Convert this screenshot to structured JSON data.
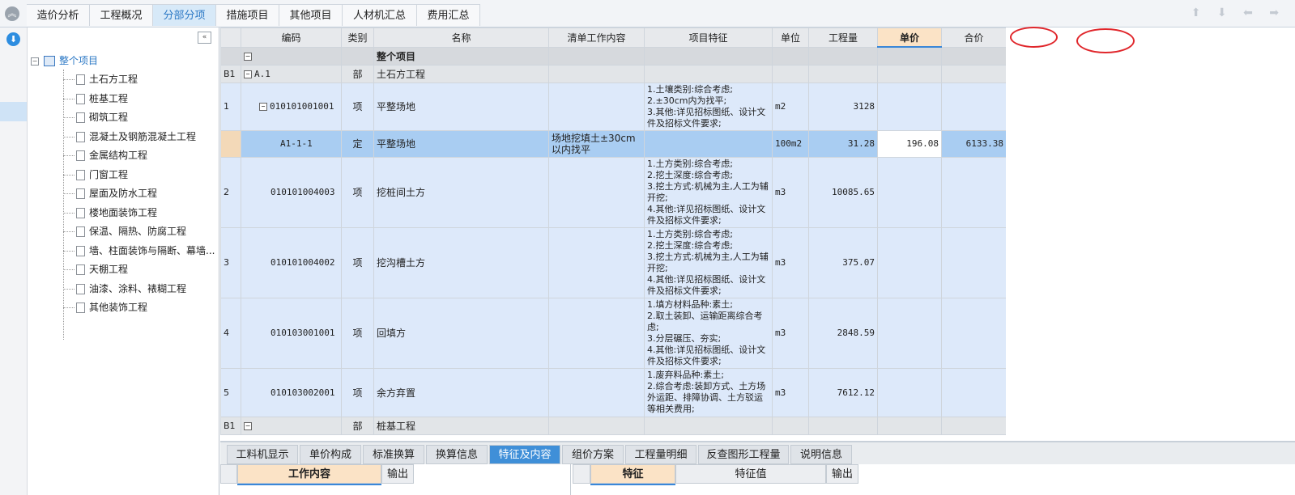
{
  "top_tabs": [
    {
      "label": "造价分析",
      "active": false
    },
    {
      "label": "工程概况",
      "active": false
    },
    {
      "label": "分部分项",
      "active": true
    },
    {
      "label": "措施项目",
      "active": false
    },
    {
      "label": "其他项目",
      "active": false
    },
    {
      "label": "人材机汇总",
      "active": false
    },
    {
      "label": "费用汇总",
      "active": false
    }
  ],
  "nav_arrows": "⬆ ⬇ ⬅ ➡",
  "tree": {
    "root": "整个项目",
    "nodes": [
      "土石方工程",
      "桩基工程",
      "砌筑工程",
      "混凝土及钢筋混凝土工程",
      "金属结构工程",
      "门窗工程",
      "屋面及防水工程",
      "楼地面装饰工程",
      "保温、隔热、防腐工程",
      "墙、柱面装饰与隔断、幕墙...",
      "天棚工程",
      "油漆、涂料、裱糊工程",
      "其他装饰工程"
    ]
  },
  "grid": {
    "headers": [
      "编码",
      "类别",
      "名称",
      "清单工作内容",
      "项目特征",
      "单位",
      "工程量",
      "单价",
      "合价"
    ],
    "rows": [
      {
        "type": "root",
        "idx": "",
        "code": "",
        "cat": "",
        "name": "整个项目",
        "work": "",
        "feat": "",
        "unit": "",
        "qty": "",
        "price": "",
        "total": ""
      },
      {
        "type": "section",
        "idx": "B1",
        "code": "A.1",
        "cat": "部",
        "name": "土石方工程",
        "work": "",
        "feat": "",
        "unit": "",
        "qty": "",
        "price": "",
        "total": ""
      },
      {
        "type": "item",
        "idx": "1",
        "code": "010101001001",
        "cat": "项",
        "name": "平整场地",
        "work": "",
        "feat": "1.土壤类别:综合考虑;\n2.±30cm内为找平;\n3.其他:详见招标图纸、设计文件及招标文件要求;",
        "unit": "m2",
        "qty": "3128",
        "price": "",
        "total": ""
      },
      {
        "type": "quota",
        "idx": "",
        "code": "A1-1-1",
        "cat": "定",
        "name": "平整场地",
        "work": "场地挖填土±30cm以内找平",
        "feat": "",
        "unit": "100m2",
        "qty": "31.28",
        "price": "196.08",
        "total": "6133.38"
      },
      {
        "type": "item",
        "idx": "2",
        "code": "010101004003",
        "cat": "项",
        "name": "挖桩间土方",
        "work": "",
        "feat": "1.土方类别:综合考虑;\n2.挖土深度:综合考虑;\n3.挖土方式:机械为主,人工为辅开挖;\n4.其他:详见招标图纸、设计文件及招标文件要求;",
        "unit": "m3",
        "qty": "10085.65",
        "price": "",
        "total": ""
      },
      {
        "type": "item",
        "idx": "3",
        "code": "010101004002",
        "cat": "项",
        "name": "挖沟槽土方",
        "work": "",
        "feat": "1.土方类别:综合考虑;\n2.挖土深度:综合考虑;\n3.挖土方式:机械为主,人工为辅开挖;\n4.其他:详见招标图纸、设计文件及招标文件要求;",
        "unit": "m3",
        "qty": "375.07",
        "price": "",
        "total": ""
      },
      {
        "type": "item",
        "idx": "4",
        "code": "010103001001",
        "cat": "项",
        "name": "回填方",
        "work": "",
        "feat": "1.填方材料品种:素土;\n2.取土装卸、运输距离综合考虑;\n3.分层碾压、夯实;\n4.其他:详见招标图纸、设计文件及招标文件要求;",
        "unit": "m3",
        "qty": "2848.59",
        "price": "",
        "total": ""
      },
      {
        "type": "item",
        "idx": "5",
        "code": "010103002001",
        "cat": "项",
        "name": "余方弃置",
        "work": "",
        "feat": "1.废弃料品种:素土;\n2.综合考虑:装卸方式、土方场外运距、排障协调、土方驳运等相关费用;",
        "unit": "m3",
        "qty": "7612.12",
        "price": "",
        "total": ""
      },
      {
        "type": "section",
        "idx": "B1",
        "code": "",
        "cat": "部",
        "name": "桩基工程",
        "work": "",
        "feat": "",
        "unit": "",
        "qty": "",
        "price": "",
        "total": ""
      }
    ]
  },
  "bottom_tabs": [
    {
      "label": "工料机显示",
      "active": false
    },
    {
      "label": "单价构成",
      "active": false
    },
    {
      "label": "标准换算",
      "active": false
    },
    {
      "label": "换算信息",
      "active": false
    },
    {
      "label": "特征及内容",
      "active": true
    },
    {
      "label": "组价方案",
      "active": false
    },
    {
      "label": "工程量明细",
      "active": false
    },
    {
      "label": "反查图形工程量",
      "active": false
    },
    {
      "label": "说明信息",
      "active": false
    }
  ],
  "sub_left": {
    "col1": "工作内容",
    "col2": "输出"
  },
  "sub_right": {
    "col1": "特征",
    "col2": "特征值",
    "col3": "输出"
  },
  "colors": {
    "accent": "#3f8fd8",
    "highlight_header": "#fbe3c6",
    "annotation": "#e0262b"
  }
}
